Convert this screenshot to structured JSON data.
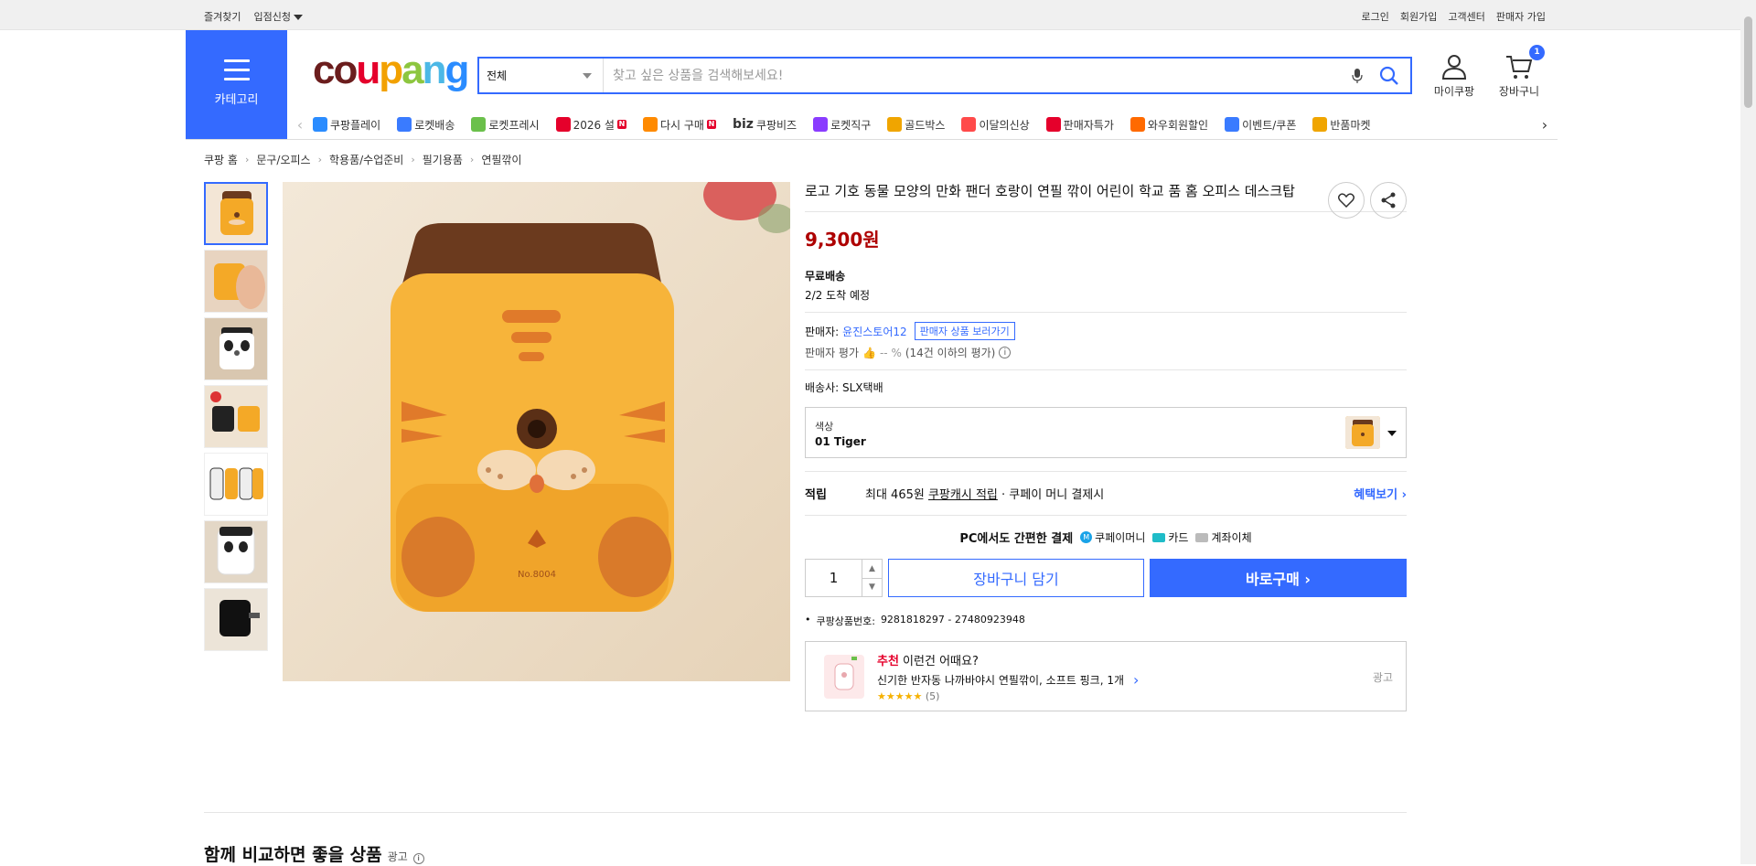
{
  "topbar": {
    "left": [
      "즐겨찾기",
      "입점신청"
    ],
    "right": [
      "로그인",
      "회원가입",
      "고객센터",
      "판매자 가입"
    ]
  },
  "header": {
    "category_label": "카테고리",
    "logo_letters": [
      "c",
      "o",
      "u",
      "p",
      "a",
      "n",
      "g"
    ],
    "search_scope": "전체",
    "search_placeholder": "찾고 싶은 상품을 검색해보세요!",
    "my_label": "마이쿠팡",
    "cart_label": "장바구니",
    "cart_count": "1"
  },
  "nav": [
    {
      "label": "쿠팡플레이",
      "icon": "play-icon",
      "color": "#2a8cff"
    },
    {
      "label": "로켓배송",
      "icon": "rocket-icon",
      "color": "#3a7bff"
    },
    {
      "label": "로켓프레시",
      "icon": "rocket-fresh-icon",
      "color": "#6bc04b"
    },
    {
      "label": "2026 설",
      "icon": "gift-icon",
      "color": "#e5002b",
      "new": "N"
    },
    {
      "label": "다시 구매",
      "icon": "rebuy-icon",
      "color": "#ff8a00",
      "new": "N"
    },
    {
      "label": "쿠팡비즈",
      "icon": "biz-icon",
      "color": "#555",
      "prefix": "biz"
    },
    {
      "label": "로켓직구",
      "icon": "globe-icon",
      "color": "#8a3cff"
    },
    {
      "label": "골드박스",
      "icon": "goldbox-icon",
      "color": "#f0a500"
    },
    {
      "label": "이달의신상",
      "icon": "new-icon",
      "color": "#ff4a4a"
    },
    {
      "label": "판매자특가",
      "icon": "percent-icon",
      "color": "#e5002b"
    },
    {
      "label": "와우회원할인",
      "icon": "wow-icon",
      "color": "#ff6a00"
    },
    {
      "label": "이벤트/쿠폰",
      "icon": "coupon-icon",
      "color": "#3a7bff"
    },
    {
      "label": "반품마켓",
      "icon": "market-icon",
      "color": "#f0a500"
    }
  ],
  "breadcrumb": [
    "쿠팡 홈",
    "문구/오피스",
    "학용품/수업준비",
    "필기용품",
    "연필깎이"
  ],
  "product": {
    "title": "로고 기호 동물 모양의 만화 팬더 호랑이 연필 깎이 어린이 학교 품 홈 오피스 데스크탑",
    "price": "9,300원",
    "shipping_title": "무료배송",
    "shipping_eta": "2/2 도착 예정",
    "seller_label": "판매자:",
    "seller_name": "윤진스토어12",
    "seller_tag": "판매자 상품 보러가기",
    "rating_label": "판매자 평가",
    "rating_value": "-- %",
    "rating_note": "(14건 이하의 평가)",
    "carrier_label": "배송사:",
    "carrier_name": "SLX택배",
    "option_label": "색상",
    "option_value": "01 Tiger",
    "reward_key": "적립",
    "reward_text": "최대 465원",
    "reward_link": "쿠팡캐시 적립",
    "reward_tail": "· 쿠페이 머니 결제시",
    "reward_more": "혜택보기 ›",
    "pay_title": "PC에서도 간편한 결제",
    "pay_methods": [
      "쿠페이머니",
      "카드",
      "계좌이체"
    ],
    "qty": "1",
    "cart_btn": "장바구니 담기",
    "buy_btn": "바로구매 ›",
    "code_label": "쿠팡상품번호:",
    "code_value": "9281818297 - 27480923948"
  },
  "recommend": {
    "red": "추천",
    "rest": " 이런건 어때요?",
    "item": "신기한 반자동 나까바야시 연필깎이, 소프트 핑크, 1개",
    "stars": "★★★★★",
    "reviews": "(5)",
    "ad": "광고"
  },
  "compare": {
    "title": "함께 비교하면 좋을 상품",
    "ad": "광고"
  },
  "colors": {
    "accent": "#346aff",
    "price": "#ae0000",
    "tiger": "#f4a927",
    "brown": "#6b3a1e"
  }
}
